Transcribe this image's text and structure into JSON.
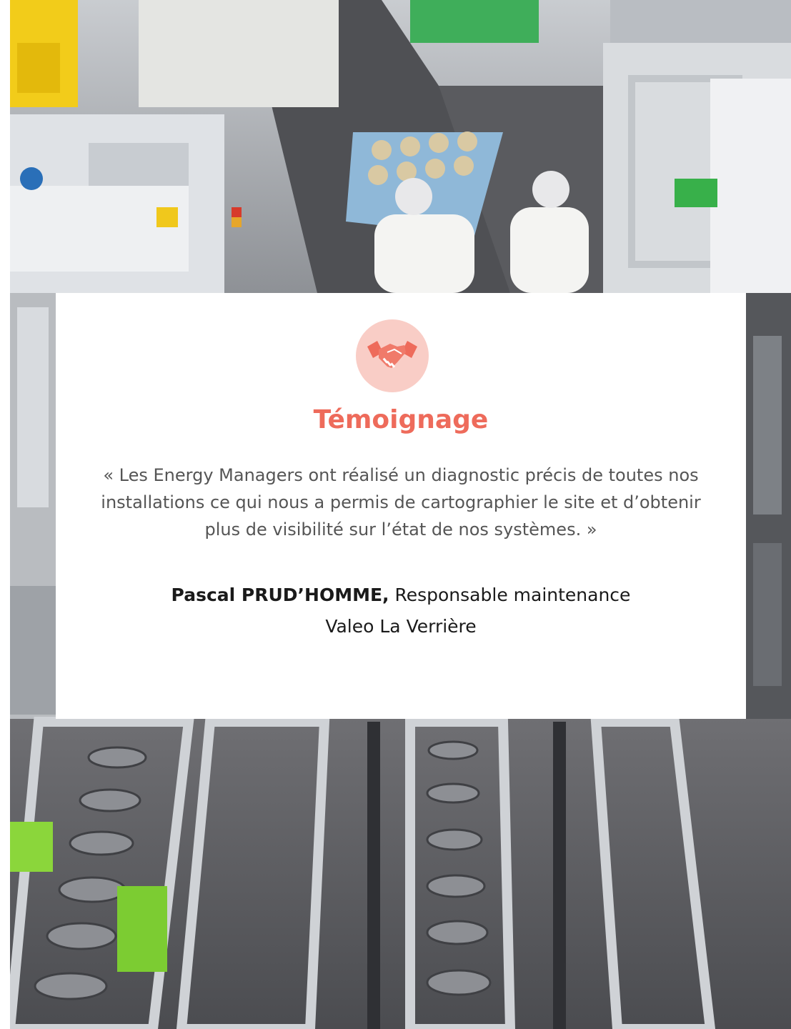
{
  "colors": {
    "accent": "#ee6b5b",
    "icon_background": "#f9cdc6",
    "card_background": "#ffffff",
    "quote_text": "#555555",
    "author_text": "#1a1a1a"
  },
  "background": {
    "icon": "factory-photo"
  },
  "testimonial": {
    "icon": "handshake-icon",
    "heading": "Témoignage",
    "quote": "« Les Energy Managers ont réalisé un diagnostic précis de toutes nos installations ce qui nous a permis de cartographier le site et d’obtenir plus de visibilité sur l’état de nos systèmes. »",
    "author_name": "Pascal PRUD’HOMME,",
    "author_role": " Responsable maintenance",
    "company": "Valeo La Verrière"
  }
}
